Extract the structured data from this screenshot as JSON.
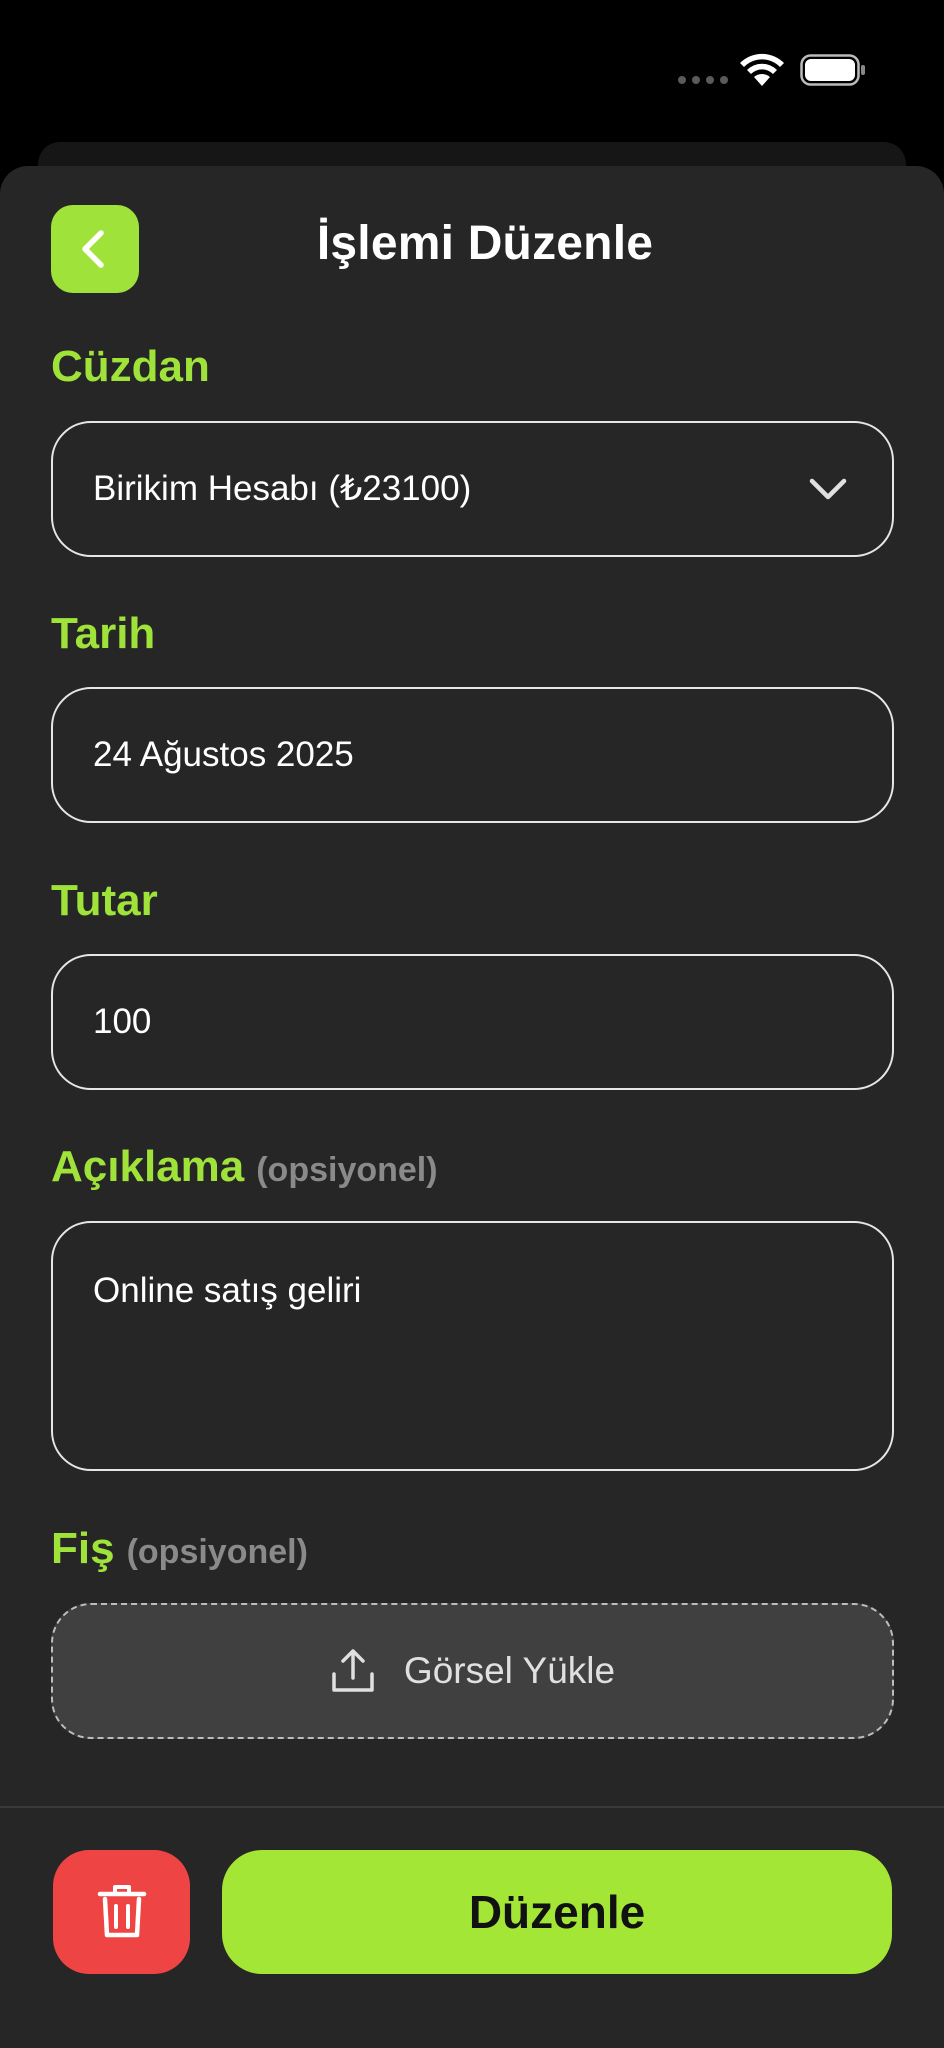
{
  "header": {
    "title": "İşlemi Düzenle",
    "back_icon": "chevron-left-icon"
  },
  "wallet": {
    "label": "Cüzdan",
    "selected": "Birikim Hesabı (₺23100)",
    "icon": "chevron-down-icon"
  },
  "date": {
    "label": "Tarih",
    "value": "24 Ağustos 2025"
  },
  "amount": {
    "label": "Tutar",
    "value": "100"
  },
  "description": {
    "label": "Açıklama",
    "optional": "(opsiyonel)",
    "value": "Online satış geliri"
  },
  "receipt": {
    "label": "Fiş",
    "optional": "(opsiyonel)",
    "upload_label": "Görsel Yükle",
    "icon": "upload-icon"
  },
  "footer": {
    "delete_icon": "trash-icon",
    "submit_label": "Düzenle"
  },
  "colors": {
    "accent": "#a3e635",
    "danger": "#ef4444",
    "background": "#262626"
  }
}
